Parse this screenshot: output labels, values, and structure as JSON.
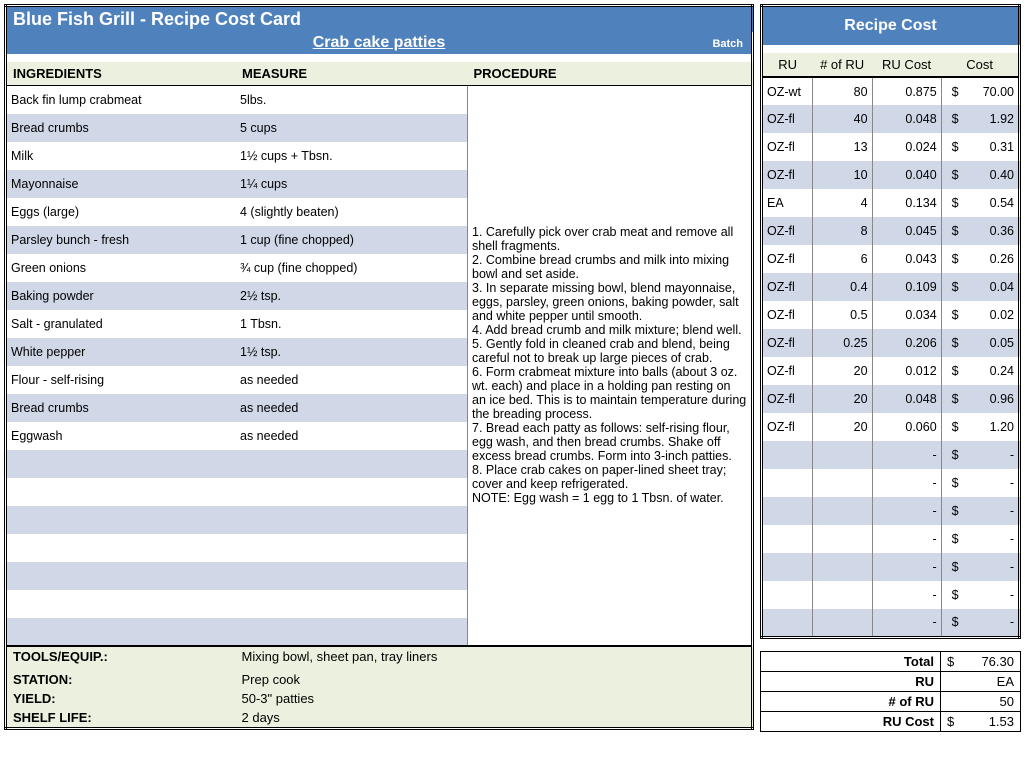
{
  "header": {
    "title": "Blue Fish Grill - Recipe Cost Card",
    "recipe_name": "Crab cake patties",
    "batch_label": "Batch"
  },
  "columns": {
    "ingredients": "INGREDIENTS",
    "measure": "MEASURE",
    "procedure": "PROCEDURE"
  },
  "ingredients": [
    {
      "name": "Back fin lump crabmeat",
      "measure": "5lbs."
    },
    {
      "name": "Bread crumbs",
      "measure": "5 cups"
    },
    {
      "name": "Milk",
      "measure": "1½ cups + Tbsn."
    },
    {
      "name": "Mayonnaise",
      "measure": "1¼ cups"
    },
    {
      "name": "Eggs (large)",
      "measure": "4 (slightly beaten)"
    },
    {
      "name": "Parsley bunch - fresh",
      "measure": "1 cup (fine chopped)"
    },
    {
      "name": "Green onions",
      "measure": "¾ cup (fine chopped)"
    },
    {
      "name": "Baking powder",
      "measure": "2½ tsp."
    },
    {
      "name": "Salt - granulated",
      "measure": "1 Tbsn."
    },
    {
      "name": "White pepper",
      "measure": "1½ tsp."
    },
    {
      "name": "Flour - self-rising",
      "measure": "as needed"
    },
    {
      "name": "Bread crumbs",
      "measure": "as needed"
    },
    {
      "name": "Eggwash",
      "measure": "as needed"
    },
    {
      "name": "",
      "measure": ""
    },
    {
      "name": "",
      "measure": ""
    },
    {
      "name": "",
      "measure": ""
    },
    {
      "name": "",
      "measure": ""
    },
    {
      "name": "",
      "measure": ""
    },
    {
      "name": "",
      "measure": ""
    },
    {
      "name": "",
      "measure": ""
    }
  ],
  "procedure_text": "1. Carefully pick over crab meat and remove all shell fragments.\n2. Combine bread crumbs and milk into mixing bowl and set aside.\n3. In separate missing bowl, blend mayonnaise, eggs, parsley, green onions, baking powder, salt and white pepper until smooth.\n4. Add bread crumb and milk mixture; blend well.\n5. Gently fold in cleaned crab and blend, being careful not to break up large pieces of crab.\n6. Form crabmeat mixture into balls (about 3 oz. wt. each) and place in a holding pan resting on an ice bed. This is to maintain temperature during the breading process.\n7. Bread each patty as follows: self-rising flour, egg wash, and then bread crumbs. Shake off excess bread crumbs. Form into 3-inch patties.\n8. Place crab cakes on paper-lined sheet tray; cover and keep refrigerated.\nNOTE: Egg wash = 1 egg to 1 Tbsn. of water.",
  "footer": {
    "tools_label": "TOOLS/EQUIP.:",
    "tools": "Mixing bowl, sheet pan, tray liners",
    "station_label": "STATION:",
    "station": "Prep cook",
    "yield_label": "YIELD:",
    "yield": "50-3\" patties",
    "shelf_label": "SHELF LIFE:",
    "shelf": "2 days"
  },
  "right": {
    "title": "Recipe Cost",
    "headers": {
      "ru": "RU",
      "num": "# of RU",
      "rucost": "RU Cost",
      "cost": "Cost"
    },
    "rows": [
      {
        "ru": "OZ-wt",
        "num": "80",
        "rucost": "0.875",
        "cost": "70.00"
      },
      {
        "ru": "OZ-fl",
        "num": "40",
        "rucost": "0.048",
        "cost": "1.92"
      },
      {
        "ru": "OZ-fl",
        "num": "13",
        "rucost": "0.024",
        "cost": "0.31"
      },
      {
        "ru": "OZ-fl",
        "num": "10",
        "rucost": "0.040",
        "cost": "0.40"
      },
      {
        "ru": "EA",
        "num": "4",
        "rucost": "0.134",
        "cost": "0.54"
      },
      {
        "ru": "OZ-fl",
        "num": "8",
        "rucost": "0.045",
        "cost": "0.36"
      },
      {
        "ru": "OZ-fl",
        "num": "6",
        "rucost": "0.043",
        "cost": "0.26"
      },
      {
        "ru": "OZ-fl",
        "num": "0.4",
        "rucost": "0.109",
        "cost": "0.04"
      },
      {
        "ru": "OZ-fl",
        "num": "0.5",
        "rucost": "0.034",
        "cost": "0.02"
      },
      {
        "ru": "OZ-fl",
        "num": "0.25",
        "rucost": "0.206",
        "cost": "0.05"
      },
      {
        "ru": "OZ-fl",
        "num": "20",
        "rucost": "0.012",
        "cost": "0.24"
      },
      {
        "ru": "OZ-fl",
        "num": "20",
        "rucost": "0.048",
        "cost": "0.96"
      },
      {
        "ru": "OZ-fl",
        "num": "20",
        "rucost": "0.060",
        "cost": "1.20"
      },
      {
        "ru": "",
        "num": "",
        "rucost": "-",
        "cost": "-"
      },
      {
        "ru": "",
        "num": "",
        "rucost": "-",
        "cost": "-"
      },
      {
        "ru": "",
        "num": "",
        "rucost": "-",
        "cost": "-"
      },
      {
        "ru": "",
        "num": "",
        "rucost": "-",
        "cost": "-"
      },
      {
        "ru": "",
        "num": "",
        "rucost": "-",
        "cost": "-"
      },
      {
        "ru": "",
        "num": "",
        "rucost": "-",
        "cost": "-"
      },
      {
        "ru": "",
        "num": "",
        "rucost": "-",
        "cost": "-"
      }
    ],
    "summary": {
      "total_label": "Total",
      "total": "76.30",
      "ru_label": "RU",
      "ru": "EA",
      "numru_label": "# of RU",
      "numru": "50",
      "rucost_label": "RU Cost",
      "rucost": "1.53"
    }
  }
}
